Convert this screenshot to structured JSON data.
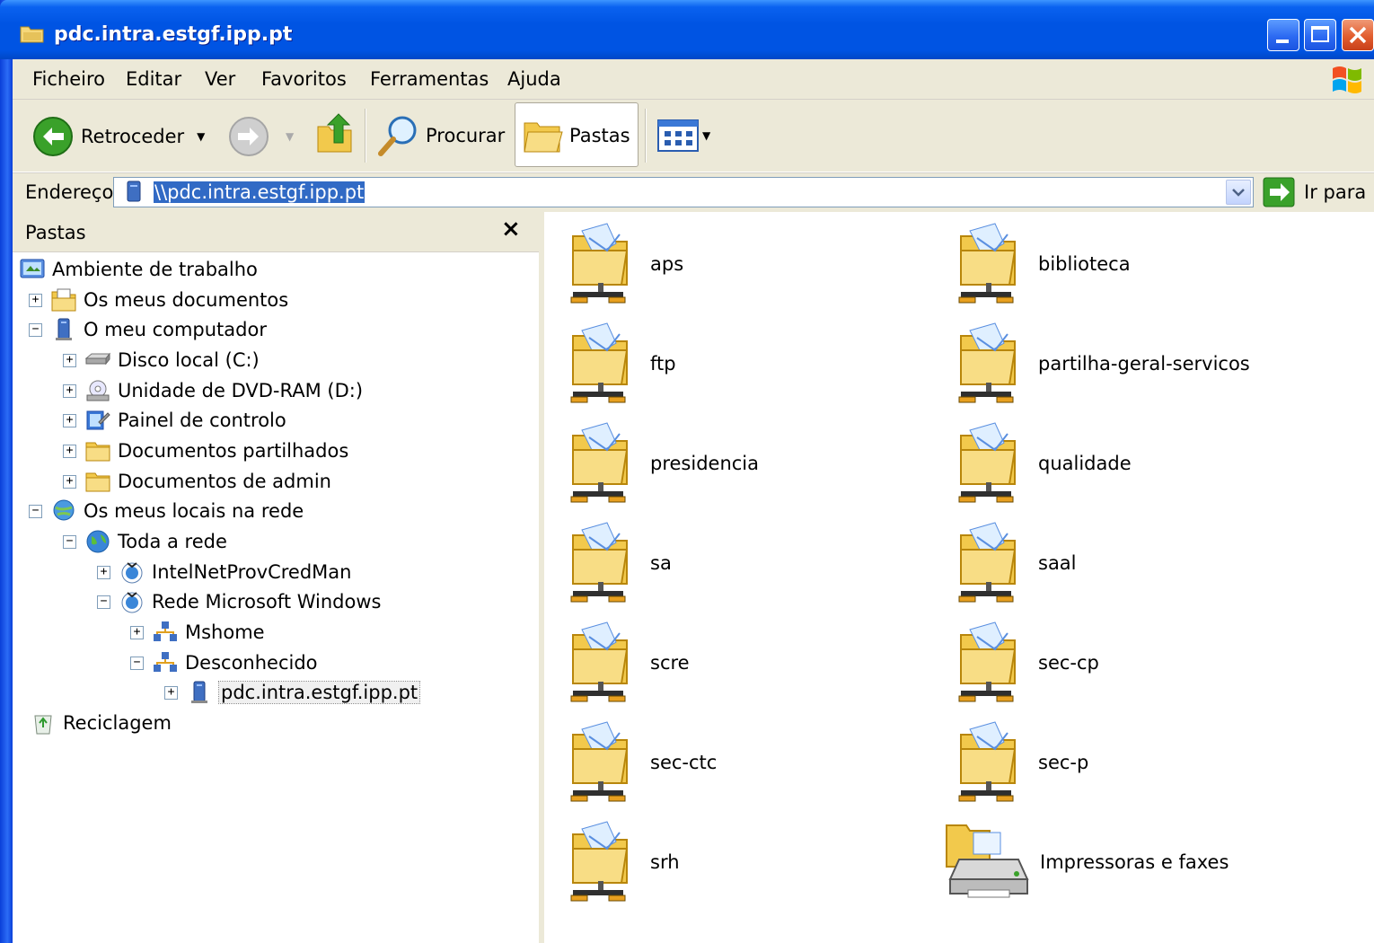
{
  "window": {
    "title": "pdc.intra.estgf.ipp.pt"
  },
  "menu": [
    "Ficheiro",
    "Editar",
    "Ver",
    "Favoritos",
    "Ferramentas",
    "Ajuda"
  ],
  "toolbar": {
    "back_label": "Retroceder",
    "search_label": "Procurar",
    "folders_label": "Pastas"
  },
  "address": {
    "label": "Endereço",
    "value": "\\\\pdc.intra.estgf.ipp.pt",
    "go_label": "Ir para"
  },
  "folders_pane": {
    "title": "Pastas",
    "close": "×",
    "tree": [
      {
        "label": "Ambiente de trabalho",
        "icon": "desktop-icon",
        "level": 0,
        "exp": ""
      },
      {
        "label": "Os meus documentos",
        "icon": "my-documents-icon",
        "level": 1,
        "exp": "+"
      },
      {
        "label": "O meu computador",
        "icon": "my-computer-icon",
        "level": 1,
        "exp": "−"
      },
      {
        "label": "Disco local (C:)",
        "icon": "hard-drive-icon",
        "level": 2,
        "exp": "+"
      },
      {
        "label": "Unidade de DVD-RAM (D:)",
        "icon": "dvd-drive-icon",
        "level": 2,
        "exp": "+"
      },
      {
        "label": "Painel de controlo",
        "icon": "control-panel-icon",
        "level": 2,
        "exp": "+"
      },
      {
        "label": "Documentos partilhados",
        "icon": "folder-icon",
        "level": 2,
        "exp": "+"
      },
      {
        "label": "Documentos de admin",
        "icon": "folder-icon",
        "level": 2,
        "exp": "+"
      },
      {
        "label": "Os meus locais na rede",
        "icon": "network-places-icon",
        "level": 1,
        "exp": "−"
      },
      {
        "label": "Toda a rede",
        "icon": "globe-icon",
        "level": 2,
        "exp": "−"
      },
      {
        "label": "IntelNetProvCredMan",
        "icon": "network-provider-icon",
        "level": 3,
        "exp": "+"
      },
      {
        "label": "Rede Microsoft Windows",
        "icon": "network-provider-icon",
        "level": 3,
        "exp": "−"
      },
      {
        "label": "Mshome",
        "icon": "workgroup-icon",
        "level": 4,
        "exp": "+"
      },
      {
        "label": "Desconhecido",
        "icon": "workgroup-icon",
        "level": 4,
        "exp": "−"
      },
      {
        "label": "pdc.intra.estgf.ipp.pt",
        "icon": "server-icon",
        "level": 5,
        "exp": "+",
        "selected": true
      },
      {
        "label": "Reciclagem",
        "icon": "recycle-bin-icon",
        "level": 1,
        "exp": ""
      }
    ]
  },
  "shares": [
    {
      "label": "aps",
      "icon": "shared-folder-icon"
    },
    {
      "label": "biblioteca",
      "icon": "shared-folder-icon"
    },
    {
      "label": "ftp",
      "icon": "shared-folder-icon"
    },
    {
      "label": "partilha-geral-servicos",
      "icon": "shared-folder-icon"
    },
    {
      "label": "presidencia",
      "icon": "shared-folder-icon"
    },
    {
      "label": "qualidade",
      "icon": "shared-folder-icon"
    },
    {
      "label": "sa",
      "icon": "shared-folder-icon"
    },
    {
      "label": "saal",
      "icon": "shared-folder-icon"
    },
    {
      "label": "scre",
      "icon": "shared-folder-icon"
    },
    {
      "label": "sec-cp",
      "icon": "shared-folder-icon"
    },
    {
      "label": "sec-ctc",
      "icon": "shared-folder-icon"
    },
    {
      "label": "sec-p",
      "icon": "shared-folder-icon"
    },
    {
      "label": "srh",
      "icon": "shared-folder-icon"
    },
    {
      "label": "Impressoras e faxes",
      "icon": "printers-faxes-icon"
    }
  ]
}
